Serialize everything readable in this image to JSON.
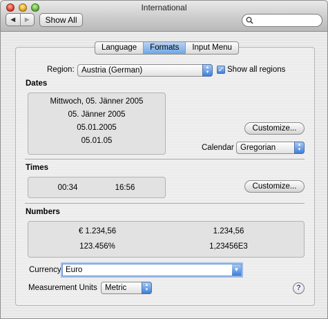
{
  "window": {
    "title": "International"
  },
  "toolbar": {
    "back": "◀",
    "forward": "▶",
    "show_all": "Show All",
    "search_placeholder": ""
  },
  "tabs": [
    {
      "label": "Language",
      "active": false
    },
    {
      "label": "Formats",
      "active": true
    },
    {
      "label": "Input Menu",
      "active": false
    }
  ],
  "region": {
    "label": "Region:",
    "value": "Austria (German)",
    "show_all_label": "Show all regions",
    "show_all_checked": true
  },
  "dates": {
    "heading": "Dates",
    "samples": [
      "Mittwoch, 05. Jänner 2005",
      "05. Jänner 2005",
      "05.01.2005",
      "05.01.05"
    ],
    "customize_label": "Customize...",
    "calendar_label": "Calendar",
    "calendar_value": "Gregorian"
  },
  "times": {
    "heading": "Times",
    "samples": [
      "00:34",
      "16:56"
    ],
    "customize_label": "Customize..."
  },
  "numbers": {
    "heading": "Numbers",
    "samples": [
      "€ 1.234,56",
      "1.234,56",
      "123.456%",
      "1,23456E3"
    ]
  },
  "currency": {
    "label": "Currency",
    "value": "Euro"
  },
  "measurement": {
    "label": "Measurement Units",
    "value": "Metric"
  },
  "help": {
    "label": "?"
  },
  "colors": {
    "accent": "#3f7fd8",
    "tab_active": "#6fa6e6"
  }
}
